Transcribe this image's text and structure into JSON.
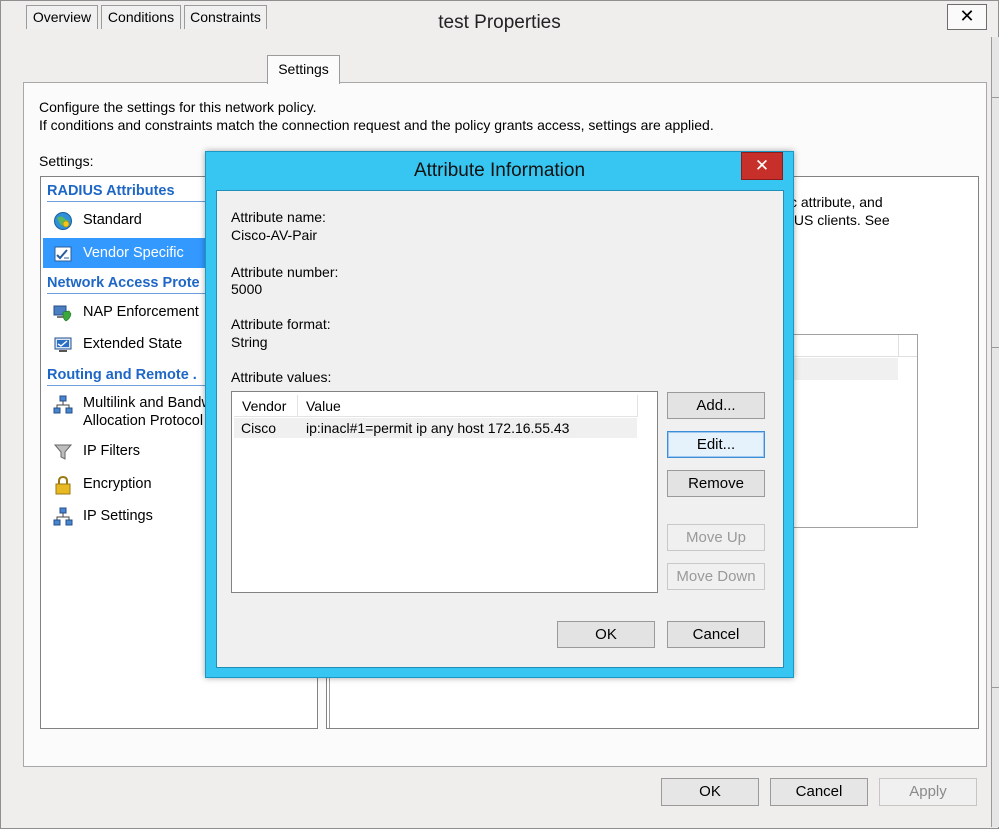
{
  "window": {
    "title": "test Properties",
    "close_glyph": "✕"
  },
  "tabs": [
    {
      "label": "Overview"
    },
    {
      "label": "Conditions"
    },
    {
      "label": "Constraints"
    },
    {
      "label": "Settings"
    }
  ],
  "description": {
    "line1": "Configure the settings for this network policy.",
    "line2": "If conditions and constraints match the connection request and the policy grants access, settings are applied."
  },
  "settings_label": "Settings:",
  "nav": {
    "groups": [
      {
        "header": "RADIUS Attributes"
      },
      {
        "header": "Network Access Prote"
      },
      {
        "header": "Routing and Remote ."
      }
    ],
    "items": [
      {
        "label": "Standard",
        "icon": "globe-icon"
      },
      {
        "label": "Vendor Specific",
        "icon": "checklist-icon"
      },
      {
        "label": "NAP Enforcement",
        "icon": "computer-shield-icon"
      },
      {
        "label": "Extended State",
        "icon": "monitor-icon"
      },
      {
        "label": "Multilink and Bandw",
        "label2": "Allocation Protocol",
        "icon": "network-icon"
      },
      {
        "label": "IP Filters",
        "icon": "funnel-icon"
      },
      {
        "label": "Encryption",
        "icon": "lock-icon"
      },
      {
        "label": "IP Settings",
        "icon": "network-icon"
      }
    ]
  },
  "right_panel": {
    "peek_line1": "c attribute, and",
    "peek_line2": "IUS clients. See"
  },
  "bottom_buttons": {
    "ok": "OK",
    "cancel": "Cancel",
    "apply": "Apply"
  },
  "dialog": {
    "title": "Attribute Information",
    "close_glyph": "✕",
    "attribute_name_label": "Attribute name:",
    "attribute_name": "Cisco-AV-Pair",
    "attribute_number_label": "Attribute number:",
    "attribute_number": "5000",
    "attribute_format_label": "Attribute format:",
    "attribute_format": "String",
    "attribute_values_label": "Attribute values:",
    "columns": [
      "Vendor",
      "Value"
    ],
    "rows": [
      {
        "vendor": "Cisco",
        "value": "ip:inacl#1=permit ip any host 172.16.55.43"
      }
    ],
    "buttons": {
      "add": "Add...",
      "edit": "Edit...",
      "remove": "Remove",
      "move_up": "Move Up",
      "move_down": "Move Down",
      "ok": "OK",
      "cancel": "Cancel"
    }
  },
  "colors": {
    "dialog_frame": "#37c6f1",
    "dialog_close": "#c7302a",
    "selection": "#3399ff",
    "group_header": "#1f67c6"
  }
}
